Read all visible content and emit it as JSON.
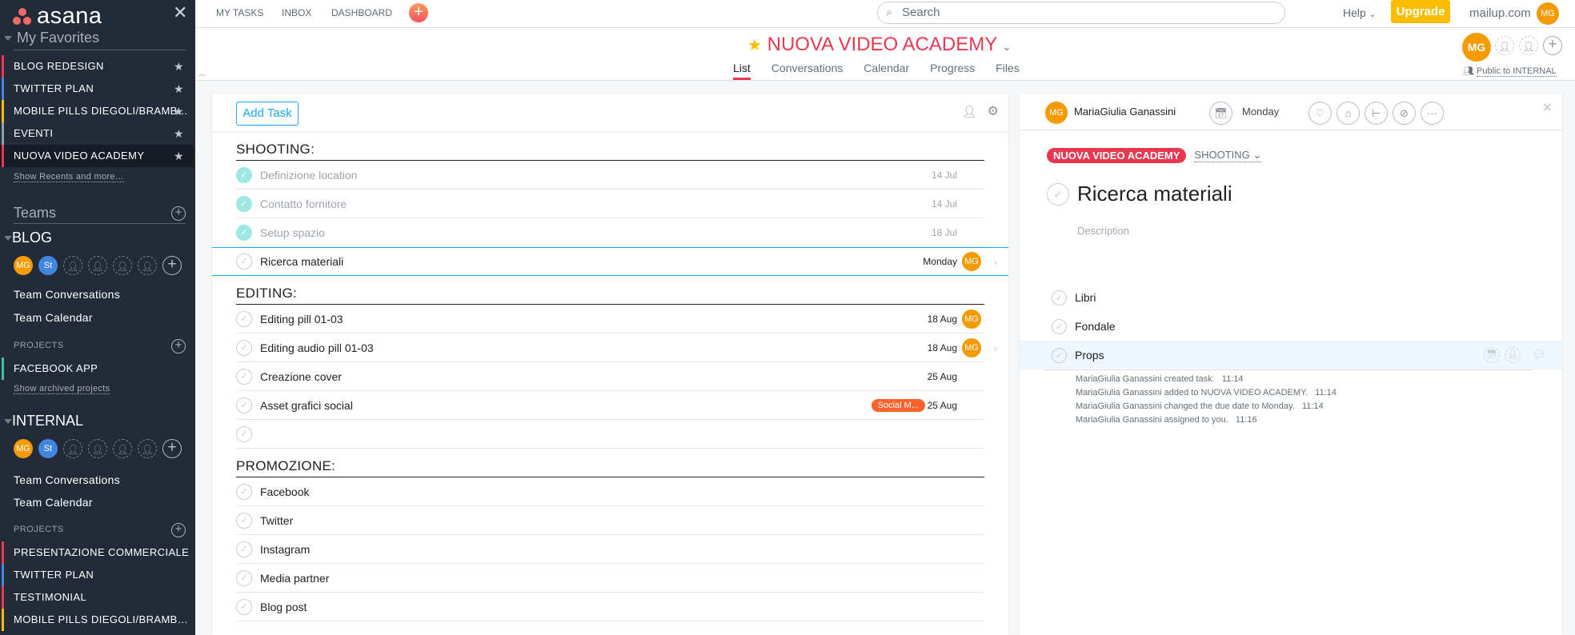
{
  "sidebar": {
    "logo": "asana",
    "favorites_title": "My Favorites",
    "favorites": [
      {
        "label": "BLOG REDESIGN",
        "color": "#e8384f"
      },
      {
        "label": "TWITTER PLAN",
        "color": "#4186e0"
      },
      {
        "label": "MOBILE PILLS DIEGOLI/BRAMB…",
        "color": "#fcbd01"
      },
      {
        "label": "EVENTI",
        "color": "#8da3a6"
      },
      {
        "label": "NUOVA VIDEO ACADEMY",
        "color": "#e8384f",
        "active": true
      }
    ],
    "show_recents": "Show Recents and more…",
    "teams_title": "Teams",
    "teams": [
      {
        "name": "BLOG",
        "members": [
          "MG",
          "St"
        ],
        "links": [
          "Team Conversations",
          "Team Calendar"
        ],
        "projects_label": "PROJECTS",
        "projects": [
          {
            "label": "FACEBOOK APP",
            "color": "#37c5ab"
          }
        ],
        "archived": "Show archived projects"
      },
      {
        "name": "INTERNAL",
        "members": [
          "MG",
          "St"
        ],
        "links": [
          "Team Conversations",
          "Team Calendar"
        ],
        "projects_label": "PROJECTS",
        "projects": [
          {
            "label": "PRESENTAZIONE COMMERCIALE",
            "color": "#e8384f"
          },
          {
            "label": "TWITTER PLAN",
            "color": "#4186e0"
          },
          {
            "label": "TESTIMONIAL",
            "color": "#e8384f"
          },
          {
            "label": "MOBILE PILLS DIEGOLI/BRAMB…",
            "color": "#fcbd01"
          }
        ]
      }
    ]
  },
  "topbar": {
    "nav": [
      "MY TASKS",
      "INBOX",
      "DASHBOARD"
    ],
    "search_placeholder": "Search",
    "help": "Help",
    "upgrade": "Upgrade",
    "org": "mailup.com",
    "avatar": "MG"
  },
  "project": {
    "title": "NUOVA VIDEO ACADEMY",
    "tabs": [
      "List",
      "Conversations",
      "Calendar",
      "Progress",
      "Files"
    ],
    "active_tab": "List",
    "members": [
      "MG"
    ],
    "visibility": "Public to INTERNAL"
  },
  "list": {
    "add_task": "Add Task",
    "sections": [
      {
        "title": "SHOOTING:",
        "tasks": [
          {
            "name": "Definizione location",
            "date": "14 Jul",
            "done": true
          },
          {
            "name": "Contatto fornitore",
            "date": "14 Jul",
            "done": true
          },
          {
            "name": "Setup spazio",
            "date": "18 Jul",
            "done": true
          },
          {
            "name": "Ricerca materiali",
            "date": "Monday",
            "assignee": "MG",
            "selected": true
          }
        ]
      },
      {
        "title": "EDITING:",
        "tasks": [
          {
            "name": "Editing pill 01-03",
            "date": "18 Aug",
            "assignee": "MG"
          },
          {
            "name": "Editing audio pill 01-03",
            "date": "18 Aug",
            "assignee": "MG",
            "chevron": true
          },
          {
            "name": "Creazione cover",
            "date": "25 Aug"
          },
          {
            "name": "Asset grafici social",
            "date": "25 Aug",
            "tag": "Social M..."
          },
          {
            "name": ""
          }
        ]
      },
      {
        "title": "PROMOZIONE:",
        "tasks": [
          {
            "name": "Facebook"
          },
          {
            "name": "Twitter"
          },
          {
            "name": "Instagram"
          },
          {
            "name": "Media partner"
          },
          {
            "name": "Blog post"
          }
        ]
      }
    ]
  },
  "detail": {
    "assignee": "MariaGiulia Ganassini",
    "assignee_initials": "MG",
    "due": "Monday",
    "project_tag": "NUOVA VIDEO ACADEMY",
    "section": "SHOOTING",
    "title": "Ricerca materiali",
    "description_placeholder": "Description",
    "subtasks": [
      "Libri",
      "Fondale",
      "Props"
    ],
    "activity": [
      "MariaGiulia Ganassini created task.   11:14",
      "MariaGiulia Ganassini added to NUOVA VIDEO ACADEMY.   11:14",
      "MariaGiulia Ganassini changed the due date to Monday.   11:14",
      "MariaGiulia Ganassini assigned to you.   11:16"
    ]
  },
  "colors": {
    "accent": "#e8384f",
    "blue": "#14aaf5",
    "avatar_mg": "#f59a00",
    "avatar_st": "#4186e0",
    "upgrade": "#fcbd01"
  }
}
